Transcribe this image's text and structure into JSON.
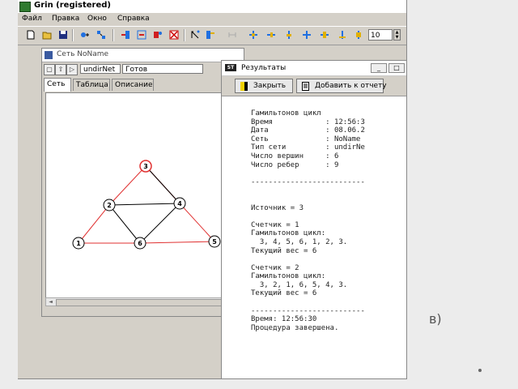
{
  "app": {
    "title": "Grin (registered)"
  },
  "menu": [
    "Файл",
    "Правка",
    "Окно",
    "Справка"
  ],
  "toolbar": {
    "spin_value": "10",
    "icons": [
      "new-file-icon",
      "open-folder-icon",
      "save-icon",
      "add-vertex-icon",
      "add-edge-icon",
      "tool-icon",
      "tool-icon",
      "tool-icon",
      "delete-icon",
      "tool-icon",
      "tool-icon",
      "tool-icon",
      "tool-icon",
      "tool-icon",
      "tool-icon",
      "tool-icon",
      "tool-icon",
      "tool-icon"
    ]
  },
  "network_window": {
    "title": "Сеть NoName",
    "graph_type": "undirNet",
    "dropdown": "Готов",
    "tabs": [
      "Сеть",
      "Таблица",
      "Описание"
    ],
    "graph": {
      "vertices": [
        {
          "id": "1"
        },
        {
          "id": "2"
        },
        {
          "id": "3"
        },
        {
          "id": "4"
        },
        {
          "id": "5"
        },
        {
          "id": "6"
        }
      ],
      "edges": [
        {
          "a": "3",
          "b": "2",
          "red": true
        },
        {
          "a": "3",
          "b": "5",
          "red": true
        },
        {
          "a": "2",
          "b": "1",
          "red": true
        },
        {
          "a": "1",
          "b": "6",
          "red": true
        },
        {
          "a": "6",
          "b": "5",
          "red": true
        },
        {
          "a": "2",
          "b": "4",
          "red": false
        },
        {
          "a": "2",
          "b": "6",
          "red": false
        },
        {
          "a": "4",
          "b": "6",
          "red": false
        },
        {
          "a": "3",
          "b": "4",
          "red": false
        }
      ],
      "colors": {
        "red": "#e03030",
        "black": "#000000"
      }
    }
  },
  "results_window": {
    "title": "Результаты",
    "close_button": "Закрыть",
    "add_button": "Добавить к отчету",
    "report_lines": [
      "Гамильтонов цикл",
      "Время            : 12:56:3",
      "Дата             : 08.06.2",
      "Сеть             : NoName",
      "Тип сети         : undirNe",
      "Число вершин     : 6",
      "Число ребер      : 9",
      "",
      "--------------------------",
      "",
      "",
      "Источник = 3",
      "",
      "Счетчик = 1",
      "Гамильтонов цикл:",
      "  3, 4, 5, 6, 1, 2, 3.",
      "Текущий вес = 6",
      "",
      "Счетчик = 2",
      "Гамильтонов цикл:",
      "  3, 2, 1, 6, 5, 4, 3.",
      "Текущий вес = 6",
      "",
      "--------------------------",
      "Время: 12:56:30",
      "Процедура завершена."
    ]
  },
  "caption": "в)"
}
